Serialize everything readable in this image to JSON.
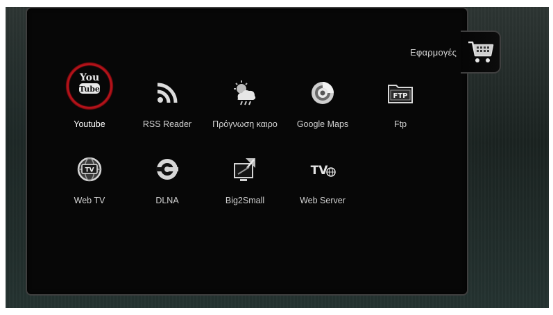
{
  "panel": {
    "title": "Εφαρμογές"
  },
  "apps": [
    {
      "label": "Youtube",
      "icon": "youtube-icon",
      "selected": true
    },
    {
      "label": "RSS Reader",
      "icon": "rss-icon"
    },
    {
      "label": "Πρόγνωση καιρο",
      "icon": "weather-icon"
    },
    {
      "label": "Google Maps",
      "icon": "google-maps-icon"
    },
    {
      "label": "Ftp",
      "icon": "ftp-folder-icon"
    },
    {
      "label": "Web TV",
      "icon": "web-tv-icon"
    },
    {
      "label": "DLNA",
      "icon": "dlna-icon"
    },
    {
      "label": "Big2Small",
      "icon": "big2small-icon"
    },
    {
      "label": "Web Server",
      "icon": "web-server-icon"
    }
  ],
  "icon_texts": {
    "youtube_top": "You",
    "youtube_bottom": "Tube",
    "ftp": "FTP",
    "webtv": "TV",
    "webserver": "TV"
  },
  "side_tab": {
    "icon": "shopping-cart-icon"
  },
  "colors": {
    "selection_ring": "#c8141c",
    "panel_bg": "#070707",
    "panel_border": "#3f3f3f",
    "label_text": "#d2d2d2"
  }
}
